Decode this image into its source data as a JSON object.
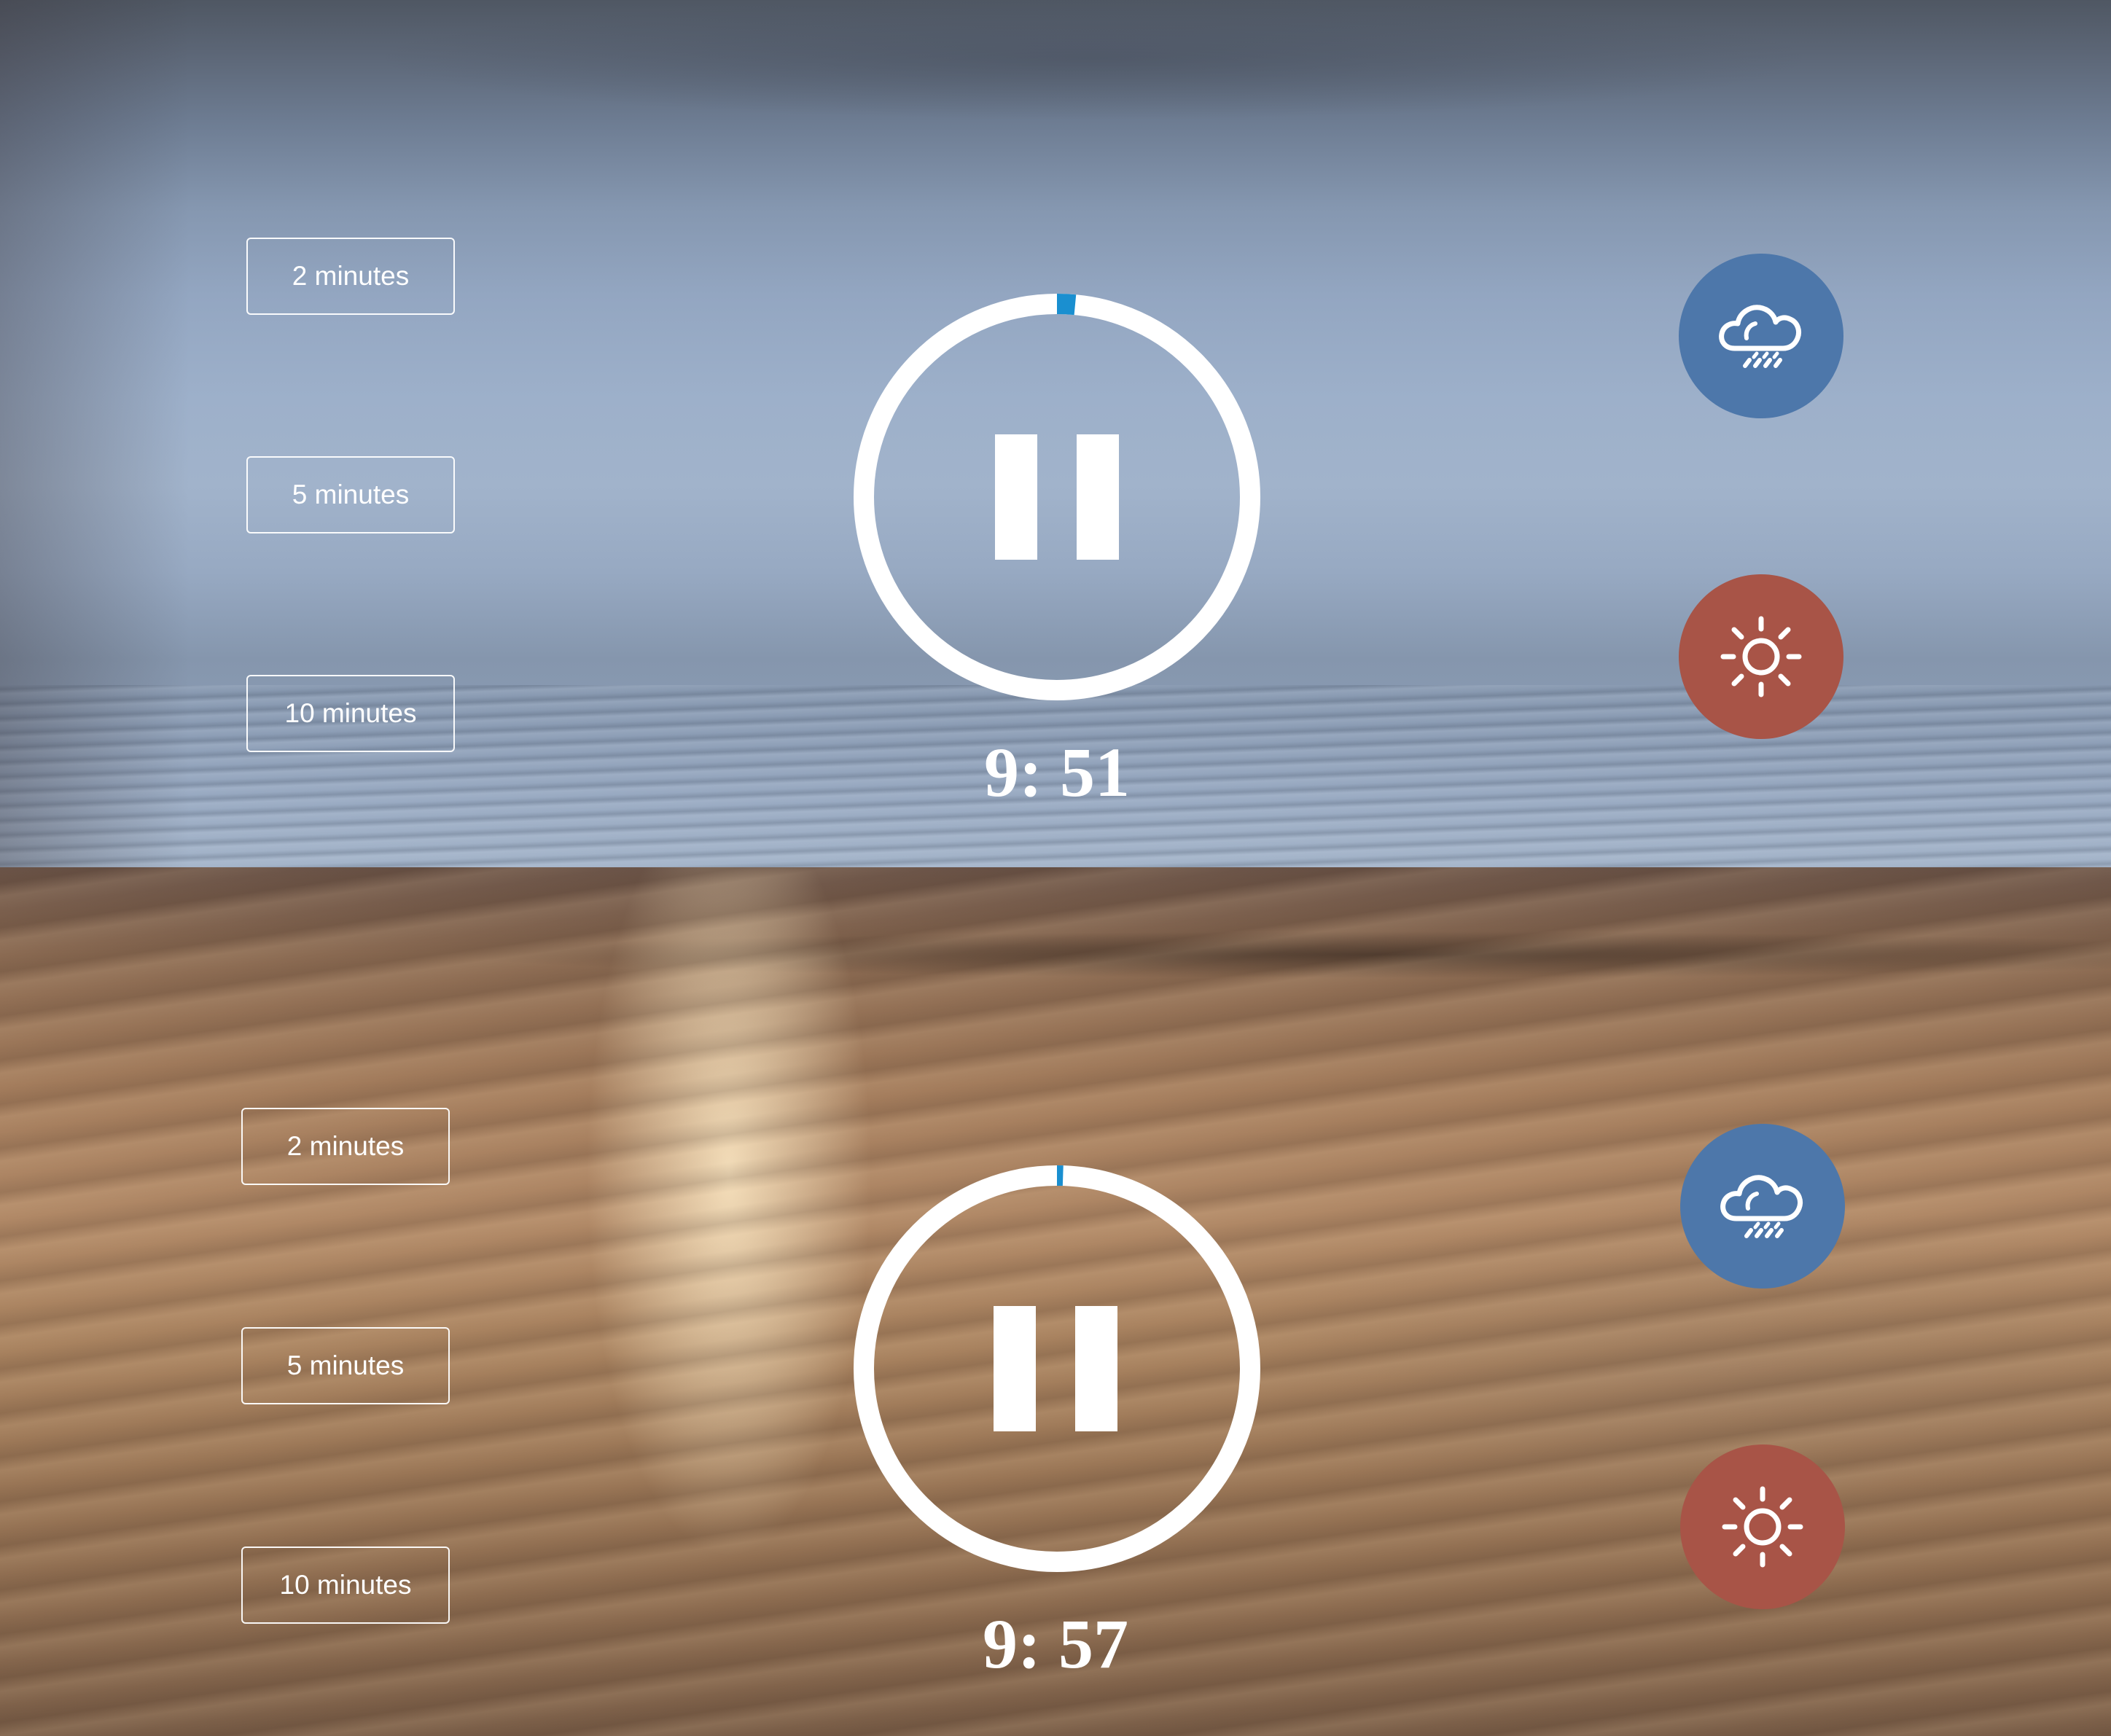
{
  "colors": {
    "ring": "#ffffff",
    "progress": "#1a8fd0",
    "rain_button": "#4d77aa",
    "sun_button": "#a85447",
    "text": "#ffffff"
  },
  "panels": [
    {
      "scene": "rain",
      "durations": [
        {
          "label": "2 minutes"
        },
        {
          "label": "5 minutes"
        },
        {
          "label": "10 minutes"
        }
      ],
      "control_state": "playing",
      "control_icon": "pause-icon",
      "time_display": "9: 51",
      "progress_fraction": 0.015,
      "theme_buttons": [
        {
          "icon": "rain-cloud-icon"
        },
        {
          "icon": "sun-icon"
        }
      ]
    },
    {
      "scene": "sun",
      "durations": [
        {
          "label": "2 minutes"
        },
        {
          "label": "5 minutes"
        },
        {
          "label": "10 minutes"
        }
      ],
      "control_state": "playing",
      "control_icon": "pause-icon",
      "time_display": "9: 57",
      "progress_fraction": 0.005,
      "theme_buttons": [
        {
          "icon": "rain-cloud-icon"
        },
        {
          "icon": "sun-icon"
        }
      ]
    }
  ]
}
